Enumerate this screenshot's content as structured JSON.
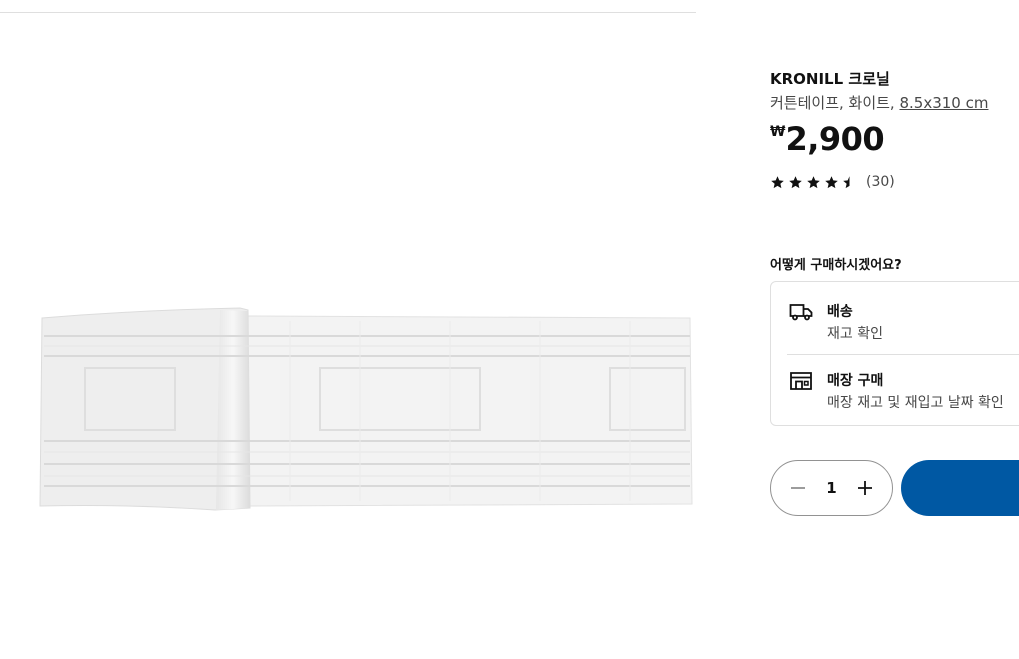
{
  "product": {
    "name": "KRONILL 크로닐",
    "description_prefix": "커튼테이프, 화이트, ",
    "size_link": "8.5x310 cm",
    "currency_symbol": "₩",
    "price": "2,900",
    "rating": 4.5,
    "review_count": "(30)"
  },
  "purchase": {
    "heading": "어떻게 구매하시겠어요?",
    "delivery": {
      "title": "배송",
      "subtitle": "재고 확인",
      "icon": "truck-icon"
    },
    "store": {
      "title": "매장 구매",
      "subtitle": "매장 재고 및 재입고 날짜 확인",
      "icon": "store-icon"
    }
  },
  "quantity": {
    "value": "1"
  },
  "colors": {
    "accent": "#0058a3",
    "text": "#111111",
    "muted": "#484848",
    "border": "#dfdfdf"
  }
}
